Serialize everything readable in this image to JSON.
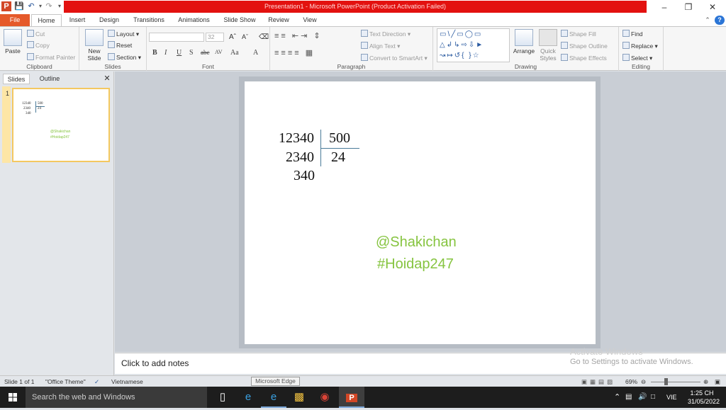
{
  "window": {
    "title": "Presentation1 - Microsoft PowerPoint (Product Activation Failed)"
  },
  "tabs": {
    "file": "File",
    "home": "Home",
    "insert": "Insert",
    "design": "Design",
    "transitions": "Transitions",
    "animations": "Animations",
    "slideshow": "Slide Show",
    "review": "Review",
    "view": "View"
  },
  "ribbon": {
    "clipboard": {
      "group": "Clipboard",
      "paste": "Paste",
      "cut": "Cut",
      "copy": "Copy",
      "format_painter": "Format Painter"
    },
    "slides": {
      "group": "Slides",
      "new_slide_1": "New",
      "new_slide_2": "Slide",
      "layout": "Layout",
      "reset": "Reset",
      "section": "Section"
    },
    "font": {
      "group": "Font",
      "size": "32"
    },
    "paragraph": {
      "group": "Paragraph",
      "text_direction": "Text Direction",
      "align_text": "Align Text",
      "convert_smartart": "Convert to SmartArt"
    },
    "drawing": {
      "group": "Drawing",
      "arrange": "Arrange",
      "quick_styles_1": "Quick",
      "quick_styles_2": "Styles",
      "shape_fill": "Shape Fill",
      "shape_outline": "Shape Outline",
      "shape_effects": "Shape Effects"
    },
    "editing": {
      "group": "Editing",
      "find": "Find",
      "replace": "Replace",
      "select": "Select"
    }
  },
  "panel": {
    "tab_slides": "Slides",
    "tab_outline": "Outline",
    "slide_number": "1"
  },
  "thumbnail": {
    "n1": "12340",
    "n2": "500",
    "n3": "2340",
    "n4": "24",
    "n5": "340",
    "handle": "@Shakichan",
    "tag": "#Hoidap247"
  },
  "slide": {
    "dividend": "12340",
    "divisor": "500",
    "remainder1": "2340",
    "quotient": "24",
    "remainder2": "340",
    "handle": "@Shakichan",
    "tag": "#Hoidap247"
  },
  "notes": {
    "placeholder": "Click to add notes"
  },
  "activation": {
    "line1": "Activate Windows",
    "line2": "Go to Settings to activate Windows."
  },
  "status": {
    "slide_of": "Slide 1 of 1",
    "theme": "\"Office Theme\"",
    "language": "Vietnamese",
    "zoom": "69%"
  },
  "taskbar": {
    "search": "Search the web and Windows",
    "tooltip": "Microsoft Edge",
    "lang": "VIE",
    "time": "1:25 CH",
    "date": "31/05/2022"
  },
  "colors": {
    "accent_red": "#e3110f",
    "file_tab": "#e5592a",
    "watermark_green": "#86c440"
  }
}
